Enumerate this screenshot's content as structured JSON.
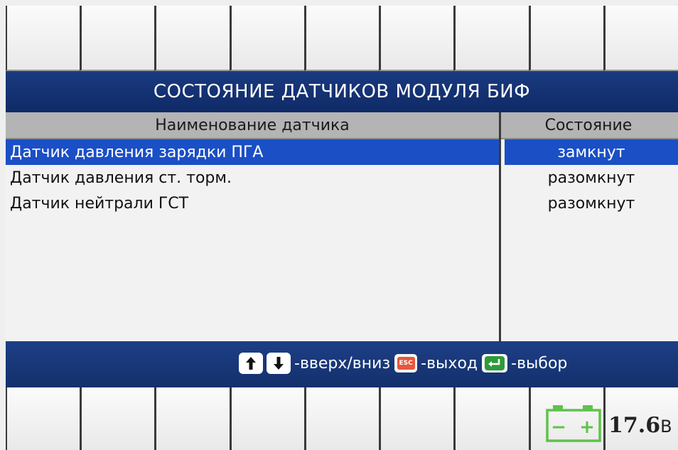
{
  "title": "СОСТОЯНИЕ ДАТЧИКОВ МОДУЛЯ БИФ",
  "table": {
    "headers": {
      "name": "Наименование датчика",
      "state": "Состояние"
    },
    "rows": [
      {
        "name": "Датчик давления зарядки ПГА",
        "state": "замкнут",
        "selected": true
      },
      {
        "name": "Датчик давления ст. торм.",
        "state": "разомкнут",
        "selected": false
      },
      {
        "name": "Датчик нейтрали ГСТ",
        "state": "разомкнут",
        "selected": false
      }
    ]
  },
  "hints": {
    "updown": "-вверх/вниз",
    "esc_key": "ESC",
    "exit": "-выход",
    "select": "-выбор"
  },
  "battery": {
    "voltage": "17.6",
    "unit": "В",
    "minus": "−",
    "plus": "+"
  },
  "colors": {
    "title_bar": "#0f2a66",
    "selected_row": "#1b4fc6",
    "header_row": "#b4b4b4",
    "esc_key": "#e8573b",
    "enter_key": "#2e9a3c",
    "battery": "#5fc24a"
  },
  "icons": {
    "up": "arrow-up-icon",
    "down": "arrow-down-icon",
    "esc": "esc-key-icon",
    "enter": "enter-key-icon",
    "battery": "battery-icon"
  }
}
